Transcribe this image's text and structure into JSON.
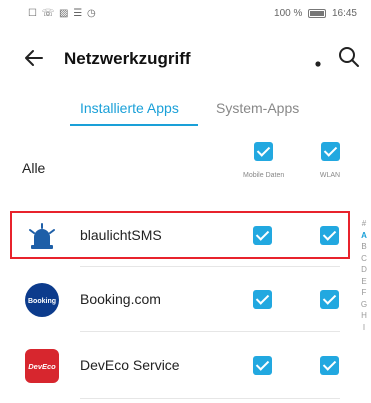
{
  "status_bar": {
    "left_icons": "☐ ☏ ▨ ☰ ◷",
    "battery_text": "100 %",
    "time": "16:45"
  },
  "header": {
    "title": "Netzwerkzugriff"
  },
  "tabs": [
    {
      "label": "Installierte Apps",
      "active": true
    },
    {
      "label": "System-Apps",
      "active": false
    }
  ],
  "all_row": {
    "label": "Alle",
    "mobile_label": "Mobile Daten",
    "wlan_label": "WLAN"
  },
  "apps": [
    {
      "name": "blaulichtSMS",
      "mobile": true,
      "wlan": true,
      "icon": "blaulicht-icon"
    },
    {
      "name": "Booking.com",
      "mobile": true,
      "wlan": true,
      "icon": "booking-icon",
      "icon_text": "Booking"
    },
    {
      "name": "DevEco Service",
      "mobile": true,
      "wlan": true,
      "icon": "deveco-icon",
      "icon_text": "DevEco"
    }
  ],
  "index_letters": [
    "#",
    "A",
    "B",
    "C",
    "D",
    "E",
    "F",
    "G",
    "H",
    "I"
  ],
  "colors": {
    "accent": "#1aa0d8",
    "checkbox": "#22a8e0",
    "highlight": "#e8232c"
  }
}
